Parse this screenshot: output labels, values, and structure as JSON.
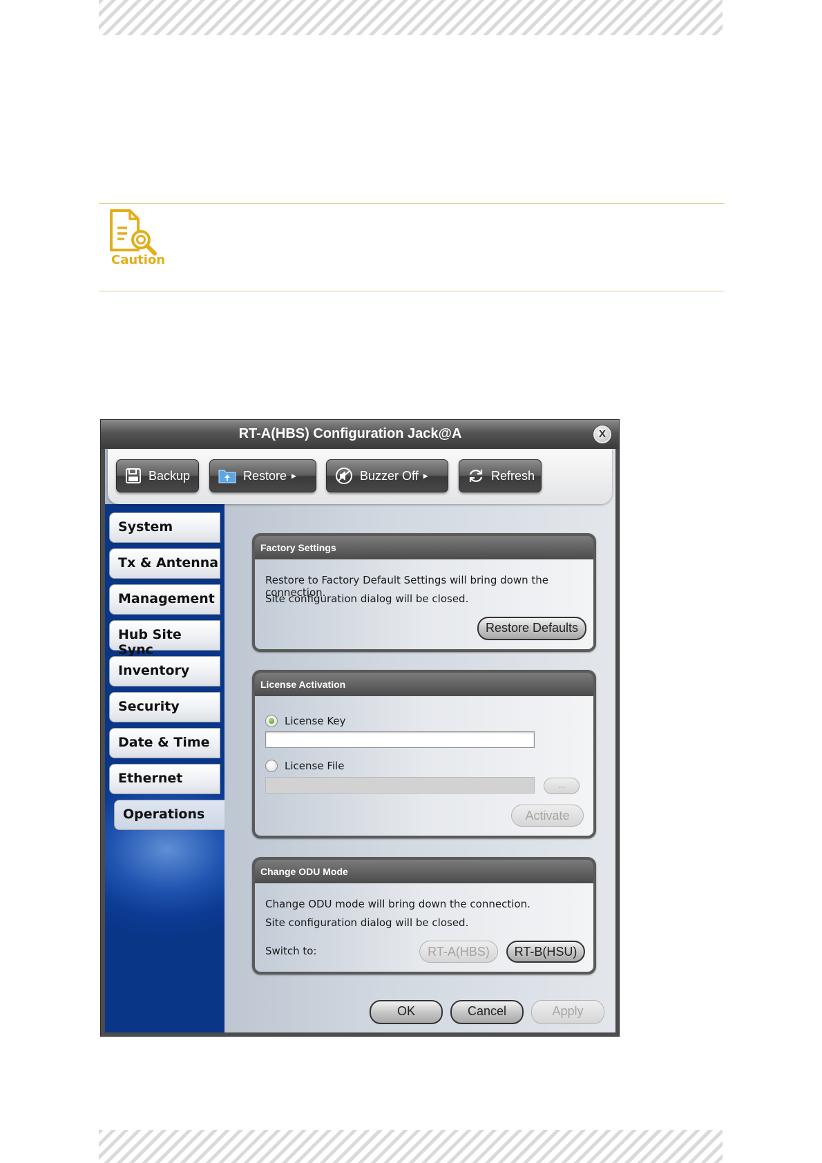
{
  "caution_label": "Caution",
  "dialog": {
    "title": "RT-A(HBS) Configuration Jack@A",
    "close_glyph": "X",
    "toolbar": {
      "backup": "Backup",
      "restore": "Restore",
      "buzzer_off": "Buzzer Off",
      "refresh": "Refresh",
      "dropdown_arrow": "▶"
    },
    "nav": [
      "System",
      "Tx & Antenna",
      "Management",
      "Hub Site Sync",
      "Inventory",
      "Security",
      "Date & Time",
      "Ethernet",
      "Operations"
    ],
    "factory": {
      "title": "Factory Settings",
      "line1": "Restore to Factory Default Settings will bring down the connection.",
      "line2": "Site configuration dialog will be closed.",
      "button": "Restore Defaults"
    },
    "license": {
      "title": "License Activation",
      "key_label": "License Key",
      "key_value": "",
      "file_label": "License File",
      "file_value": "",
      "browse": "...",
      "activate": "Activate"
    },
    "odu": {
      "title": "Change ODU Mode",
      "line1": "Change ODU mode will bring down the connection.",
      "line2": "Site configuration dialog will be closed.",
      "switch_label": "Switch to:",
      "rta": "RT-A(HBS)",
      "rtb": "RT-B(HSU)"
    },
    "ok": "OK",
    "cancel": "Cancel",
    "apply": "Apply"
  }
}
